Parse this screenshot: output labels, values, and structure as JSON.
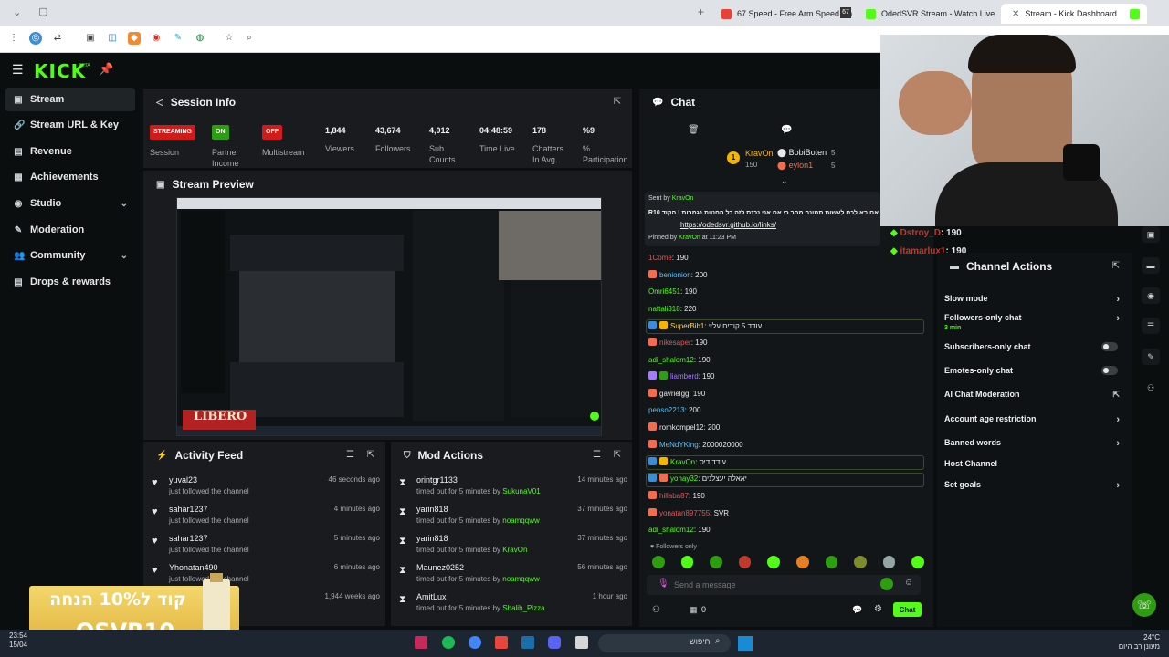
{
  "browser": {
    "tabs": [
      {
        "label": "67 Speed - Free Arm Speed Ch",
        "fav": "#e94235"
      },
      {
        "label": "OdedSVR Stream - Watch Live",
        "fav": "#53fc18"
      },
      {
        "label": "Stream - Kick Dashboard",
        "fav": "#53fc18"
      }
    ],
    "extension_badge": "67"
  },
  "kick": {
    "logo": "KICK",
    "logo_sup": "BETA"
  },
  "sidebar": {
    "items": [
      {
        "label": "Stream",
        "icon": "▣",
        "chevron": ""
      },
      {
        "label": "Stream URL & Key",
        "icon": "🔗",
        "chevron": ""
      },
      {
        "label": "Revenue",
        "icon": "▤",
        "chevron": ""
      },
      {
        "label": "Achievements",
        "icon": "▦",
        "chevron": ""
      },
      {
        "label": "Studio",
        "icon": "◉",
        "chevron": "⌄"
      },
      {
        "label": "Moderation",
        "icon": "✎",
        "chevron": ""
      },
      {
        "label": "Community",
        "icon": "👥",
        "chevron": "⌄"
      },
      {
        "label": "Drops & rewards",
        "icon": "▤",
        "chevron": ""
      }
    ]
  },
  "session": {
    "title": "Session Info",
    "stats": [
      {
        "pill": "STREAMING",
        "pill_color": "#d11a1a",
        "label": "Session"
      },
      {
        "pill": "ON",
        "pill_color": "#2e9d12",
        "label": "Partner Income"
      },
      {
        "pill": "OFF",
        "pill_color": "#d11a1a",
        "label": "Multistream"
      },
      {
        "value": "1,844",
        "label": "Viewers"
      },
      {
        "value": "43,674",
        "label": "Followers"
      },
      {
        "value": "4,012",
        "label": "Sub Counts"
      },
      {
        "value": "04:48:59",
        "label": "Time Live"
      },
      {
        "value": "178",
        "label": "Chatters In Avg."
      },
      {
        "value": "%9",
        "label": "% Participation"
      }
    ]
  },
  "preview": {
    "title": "Stream Preview",
    "overlay_text": "LIBERO"
  },
  "activity": {
    "title": "Activity Feed",
    "items": [
      {
        "name": "yuval23",
        "text": "just followed the channel",
        "time": "46 seconds ago"
      },
      {
        "name": "sahar1237",
        "text": "just followed the channel",
        "time": "4 minutes ago"
      },
      {
        "name": "sahar1237",
        "text": "just followed the channel",
        "time": "5 minutes ago"
      },
      {
        "name": "Yhonatan490",
        "text": "just followed the channel",
        "time": "6 minutes ago"
      },
      {
        "name": "",
        "text": "",
        "time": "1,944 weeks ago"
      }
    ]
  },
  "mod": {
    "title": "Mod Actions",
    "items": [
      {
        "name": "orintgr1133",
        "text": "timed out for 5 minutes by",
        "by": "SukunaV01",
        "time": "14 minutes ago"
      },
      {
        "name": "yarin818",
        "text": "timed out for 5 minutes by",
        "by": "noamqqww",
        "time": "37 minutes ago"
      },
      {
        "name": "yarin818",
        "text": "timed out for 5 minutes by",
        "by": "KravOn",
        "time": "37 minutes ago"
      },
      {
        "name": "Maunez0252",
        "text": "timed out for 5 minutes by",
        "by": "noamqqww",
        "time": "56 minutes ago"
      },
      {
        "name": "AmitLux",
        "text": "timed out for 5 minutes by",
        "by": "Shalih_Pizza",
        "time": "1 hour ago"
      }
    ]
  },
  "chat": {
    "title": "Chat",
    "leader": {
      "rank": "1",
      "name": "KravOn",
      "score": "150"
    },
    "leaders2": [
      {
        "name": "BobiBoten",
        "score": "5"
      },
      {
        "name": "eylon1",
        "score": "5"
      }
    ],
    "pinned": {
      "sent_by": "Sent by",
      "sender": "KravOn",
      "msg": "אם בא לכם לעשות תמונה מהר כי אם אני נכנס לזה כל החטות נגמרות ! הקוד OSVR10",
      "link": "https://odedsvr.github.io/links/",
      "pinned_by": "Pinned by",
      "pinner": "KravOn",
      "time": "at 11:23 PM"
    },
    "messages": [
      {
        "user": "1Come",
        "text": ": 190",
        "color": "#e05757"
      },
      {
        "user": "benionion",
        "text": ": 200",
        "color": "#53c5fc"
      },
      {
        "user": "Omri6451",
        "text": ": 190",
        "color": "#53fc18"
      },
      {
        "user": "naftali318",
        "text": ": 220",
        "color": "#53fc18"
      },
      {
        "user": "SuperBib1",
        "text": ": עודד 5 קודים עליי",
        "color": "#fcd34d"
      },
      {
        "user": "nikesaper",
        "text": ": 190",
        "color": "#e05757"
      },
      {
        "user": "adi_shalom12",
        "text": ": 190",
        "color": "#53fc18"
      },
      {
        "user": "liamberd",
        "text": ": 190",
        "color": "#a37bfc"
      },
      {
        "user": "gavrielgg",
        "text": ": 190",
        "color": "#e6e8ea"
      },
      {
        "user": "penso2213",
        "text": ": 200",
        "color": "#53c5fc"
      },
      {
        "user": "romkompel12",
        "text": ": 200",
        "color": "#e6e8ea"
      },
      {
        "user": "MeNdYKing",
        "text": ": 2000020000",
        "color": "#53c5fc"
      },
      {
        "user": "KravOn",
        "text": ": עודד דיס",
        "color": "#53fc18"
      },
      {
        "user": "yohay32",
        "text": ": יאאלה יעצלנים",
        "color": "#53fc18"
      },
      {
        "user": "hillaba87",
        "text": ": 190",
        "color": "#e05757"
      },
      {
        "user": "yonatan897755",
        "text": ": SVR",
        "color": "#e05757"
      },
      {
        "user": "adi_shalom12",
        "text": ": 190",
        "color": "#53fc18"
      }
    ],
    "followers_only": "Followers only",
    "input_placeholder": "Send a message",
    "send_label": "Chat",
    "counter": "0"
  },
  "overlay_chat": [
    {
      "user": "Dstroy_D",
      "text": ": 190"
    },
    {
      "user": "itamarlux1",
      "text": ": 190"
    }
  ],
  "channel_actions": {
    "title": "Channel Actions",
    "items": [
      {
        "label": "Slow mode",
        "sub": "",
        "control": "arrow"
      },
      {
        "label": "Followers-only chat",
        "sub": "3 min",
        "control": "arrow"
      },
      {
        "label": "Subscribers-only chat",
        "sub": "",
        "control": "toggle"
      },
      {
        "label": "Emotes-only chat",
        "sub": "",
        "control": "toggle"
      },
      {
        "label": "AI Chat Moderation",
        "sub": "",
        "control": "link"
      },
      {
        "label": "Account age restriction",
        "sub": "",
        "control": "arrow"
      },
      {
        "label": "Banned words",
        "sub": "",
        "control": "arrow"
      },
      {
        "label": "Host Channel",
        "sub": "",
        "control": ""
      },
      {
        "label": "Set goals",
        "sub": "",
        "control": "arrow"
      }
    ]
  },
  "promo": {
    "line1": "קוד ל10% הנחה",
    "line2": "OSVR10"
  },
  "taskbar": {
    "time": "23:54",
    "date": "15/04",
    "search": "חיפוש",
    "weather_temp": "24°C",
    "weather_text": "מעונן רב היום"
  },
  "colors": {
    "brand": "#53fc18",
    "live": "#d11a1a"
  }
}
